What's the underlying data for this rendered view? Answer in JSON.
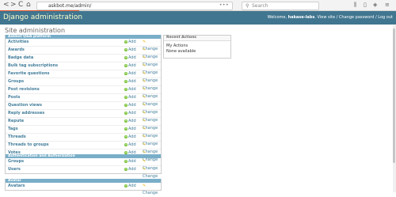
{
  "browser": {
    "back": "<",
    "forward": ">",
    "reload": "C",
    "home": "⌂",
    "url": "askbot.me/admin/",
    "url_menu": "•••",
    "search_placeholder": "Search",
    "icons": [
      "library-icon",
      "sidebar-icon",
      "shield-icon",
      "menu-icon"
    ]
  },
  "header": {
    "site_title": "Django administration",
    "welcome": "Welcome, ",
    "username": "hakase-labs",
    "view_site": "View site",
    "separator": " / ",
    "change_password": "Change password",
    "log_out": "Log out"
  },
  "page_title": "Site administration",
  "labels": {
    "add": "Add",
    "change": "Change"
  },
  "modules": [
    {
      "caption": "Askbot Q&A platform",
      "models": [
        "Activities",
        "Awards",
        "Badge data",
        "Bulk tag subscriptions",
        "Favorite questions",
        "Groups",
        "Post revisions",
        "Posts",
        "Question views",
        "Reply addresses",
        "Repute",
        "Tags",
        "Threads",
        "Threads to groups",
        "Votes"
      ]
    },
    {
      "caption": "Authentication and Authorization",
      "models": [
        "Groups",
        "Users"
      ]
    },
    {
      "caption": "Avatar",
      "models": [
        "Avatars"
      ]
    }
  ],
  "recent_actions": {
    "title": "Recent Actions",
    "subtitle": "My Actions",
    "empty": "None available"
  },
  "colors": {
    "header_bg": "#417690",
    "caption_bg": "#79aec8",
    "link": "#447e9b",
    "title": "#ffffcc",
    "add_icon": "#70bf2b"
  }
}
